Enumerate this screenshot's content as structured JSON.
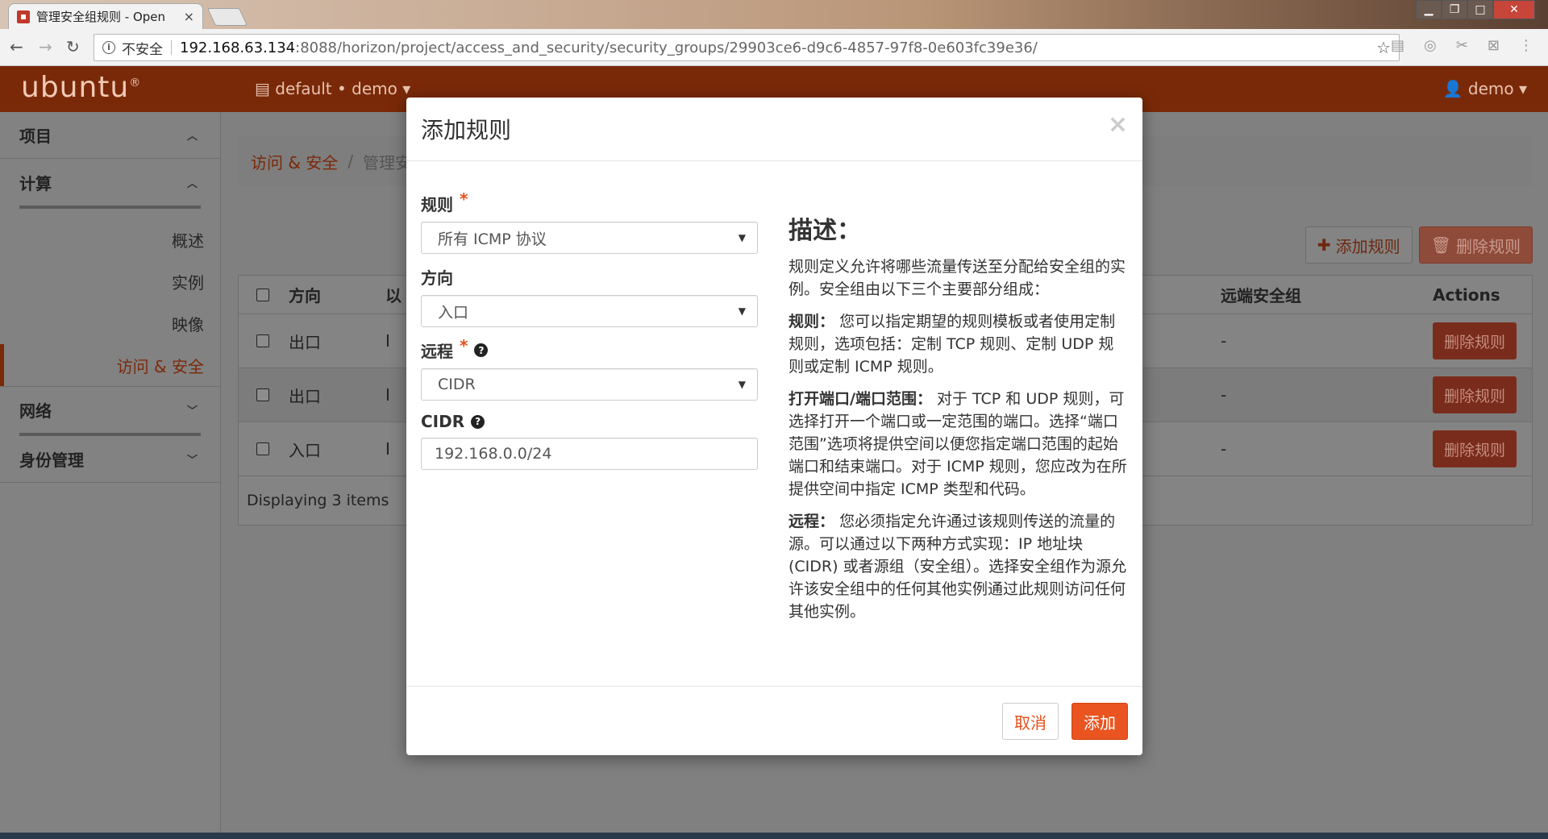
{
  "browser": {
    "tab_title": "管理安全组规则 - Open",
    "tab_close": "×",
    "insecure_label": "不安全",
    "url_host": "192.168.63.134",
    "url_path": ":8088/horizon/project/access_and_security/security_groups/29903ce6-d9c6-4857-97f8-0e603fc39e36/"
  },
  "topnav": {
    "logo": "ubuntu",
    "project_dropdown": "default • demo ▾",
    "user_dropdown": "demo ▾"
  },
  "sidebar": {
    "sections": [
      {
        "label": "项目"
      },
      {
        "label": "计算"
      },
      {
        "label": "网络"
      },
      {
        "label": "身份管理"
      }
    ],
    "items": [
      {
        "label": "概述"
      },
      {
        "label": "实例"
      },
      {
        "label": "映像"
      },
      {
        "label": "访问 & 安全"
      }
    ]
  },
  "breadcrumb": {
    "link": "访问 & 安全",
    "separator": "/",
    "current": "管理安"
  },
  "actions": {
    "add_rule": "添加规则",
    "delete_rules": "删除规则"
  },
  "table": {
    "headers": {
      "direction": "方向",
      "ether": "以",
      "remote": "远端安全组",
      "actions": "Actions"
    },
    "rows": [
      {
        "direction": "出口",
        "ether": "I",
        "remote": "-",
        "action": "删除规则"
      },
      {
        "direction": "出口",
        "ether": "I",
        "remote": "-",
        "action": "删除规则"
      },
      {
        "direction": "入口",
        "ether": "I",
        "remote": "-",
        "action": "删除规则"
      }
    ],
    "footer": "Displaying 3 items"
  },
  "modal": {
    "title": "添加规则",
    "close": "×",
    "fields": {
      "rule_label": "规则",
      "rule_value": "所有 ICMP 协议",
      "direction_label": "方向",
      "direction_value": "入口",
      "remote_label": "远程",
      "remote_value": "CIDR",
      "cidr_label": "CIDR",
      "cidr_value": "192.168.0.0/24",
      "required_mark": "*"
    },
    "description": {
      "title": "描述：",
      "intro": "规则定义允许将哪些流量传送至分配给安全组的实例。安全组由以下三个主要部分组成：",
      "rule_title": "规则：",
      "rule_text": "您可以指定期望的规则模板或者使用定制规则，选项包括：定制 TCP 规则、定制 UDP 规则或定制 ICMP 规则。",
      "port_title": "打开端口/端口范围：",
      "port_text": "对于 TCP 和 UDP 规则，可选择打开一个端口或一定范围的端口。选择“端口范围”选项将提供空间以便您指定端口范围的起始端口和结束端口。对于 ICMP 规则，您应改为在所提供空间中指定 ICMP 类型和代码。",
      "remote_title": "远程：",
      "remote_text": "您必须指定允许通过该规则传送的流量的源。可以通过以下两种方式实现：IP 地址块 (CIDR) 或者源组（安全组）。选择安全组作为源允许该安全组中的任何其他实例通过此规则访问任何其他实例。"
    },
    "cancel": "取消",
    "submit": "添加"
  }
}
